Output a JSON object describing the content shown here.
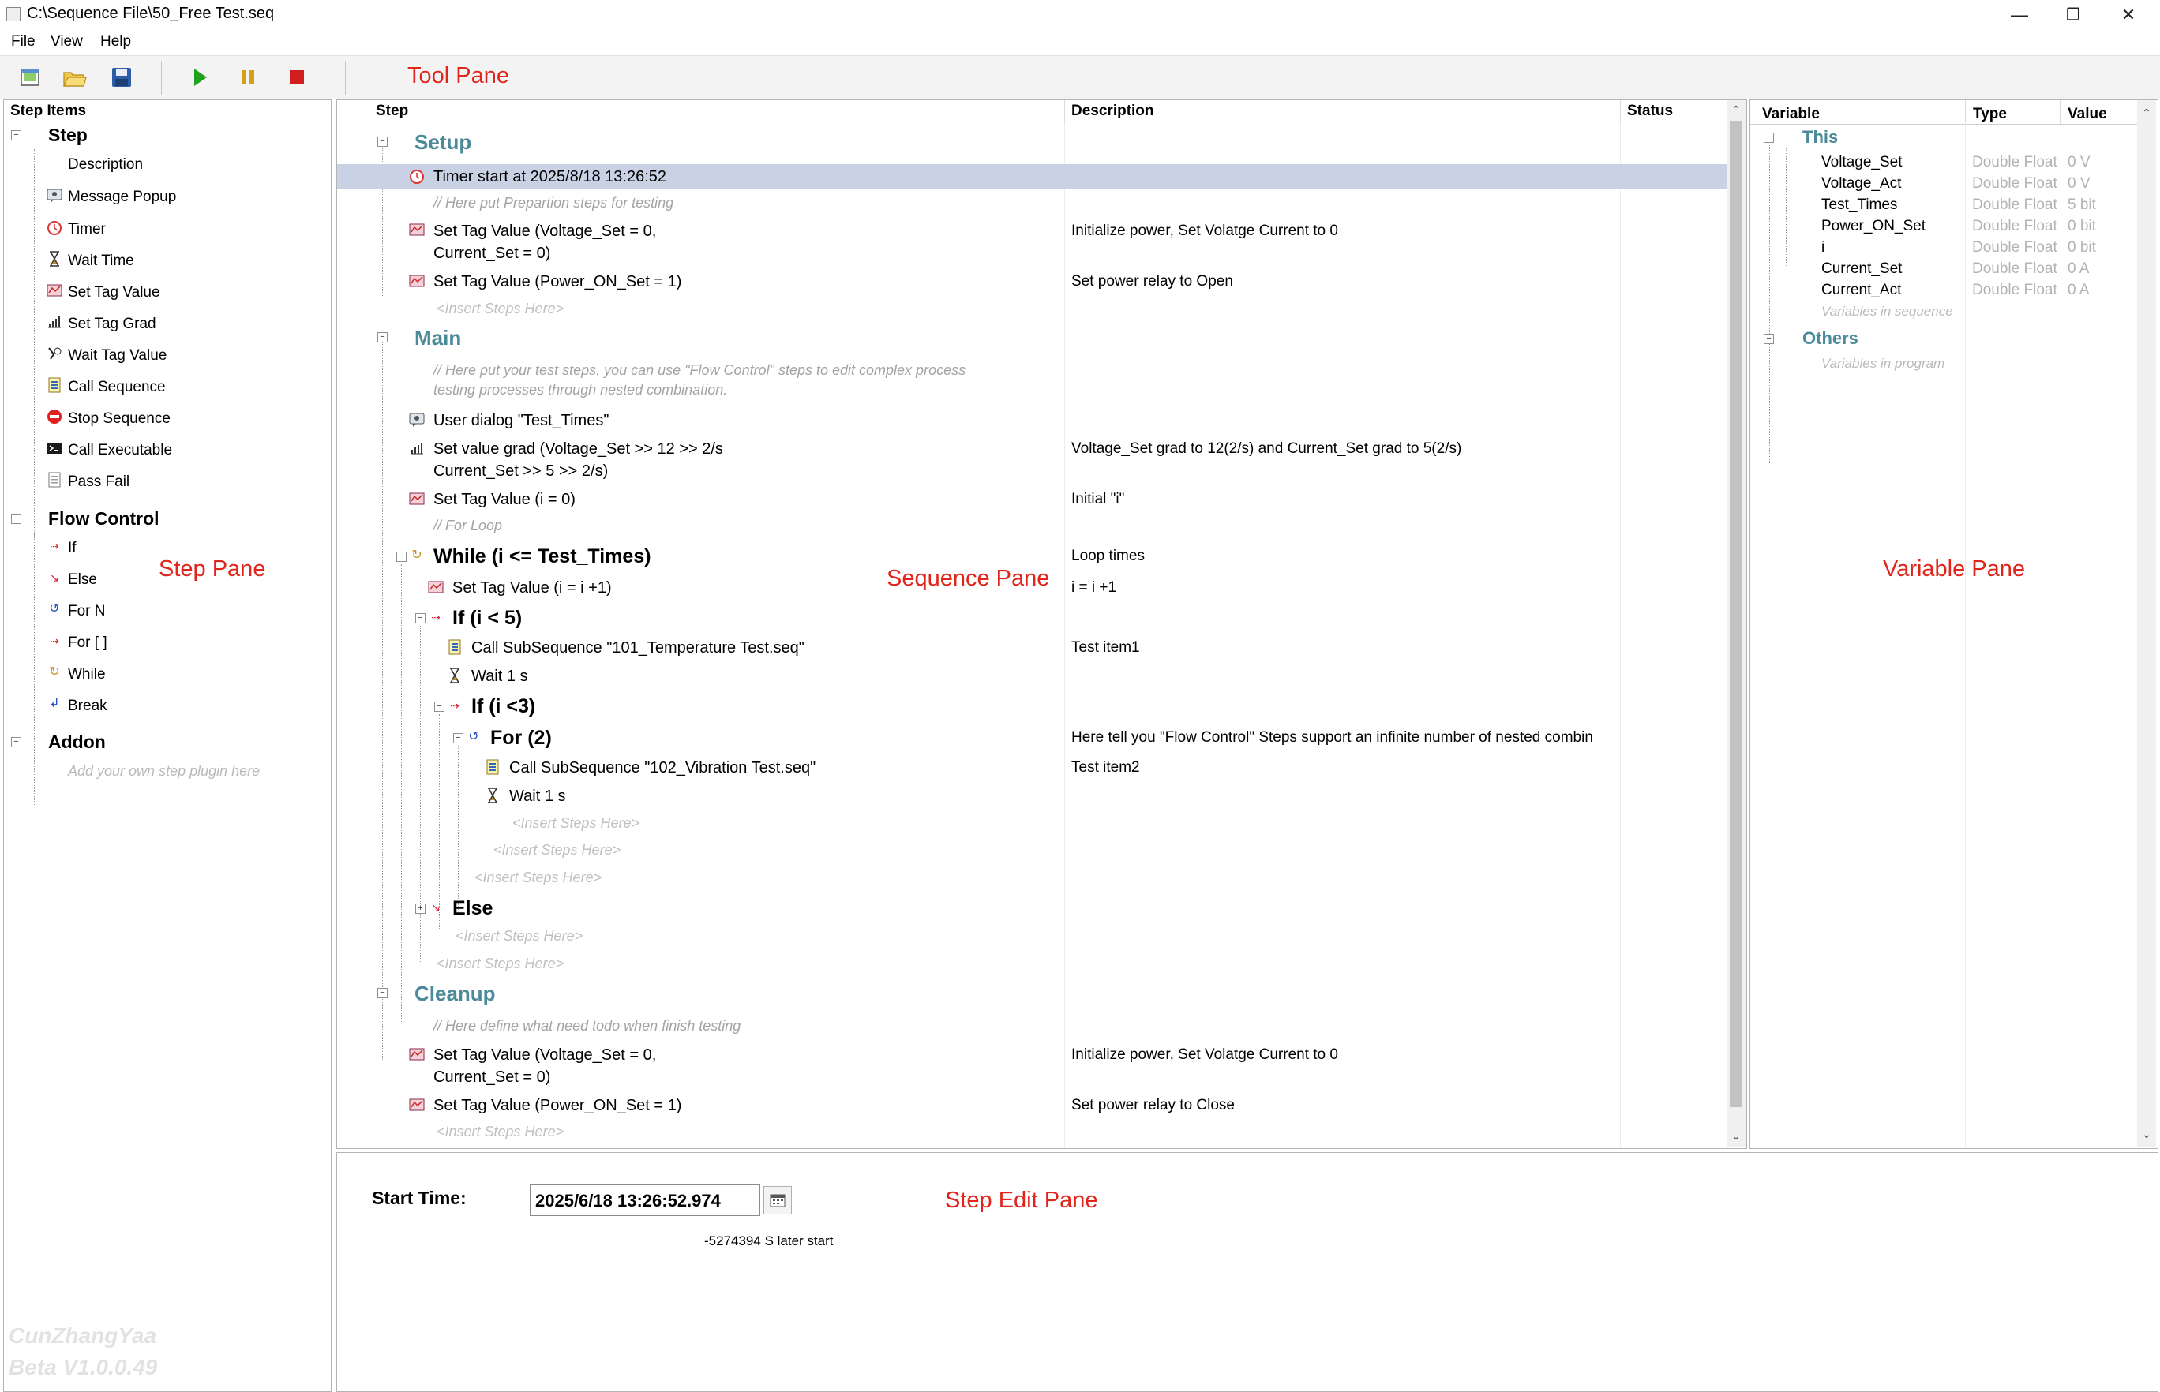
{
  "window": {
    "title": "C:\\Sequence File\\50_Free Test.seq",
    "minimize": "—",
    "restore": "❐",
    "close": "✕"
  },
  "menu": [
    "File",
    "View",
    "Help"
  ],
  "toolbar": {
    "buttons": [
      "new-icon",
      "open-icon",
      "save-icon",
      "run-icon",
      "pause-icon",
      "stop-icon"
    ],
    "colors": {
      "run": "#1fa31f",
      "pause": "#d4a017",
      "stop": "#d11f1f"
    }
  },
  "annotations": {
    "tool_pane": "Tool Pane",
    "step_pane": "Step Pane",
    "sequence_pane": "Sequence Pane",
    "variable_pane": "Variable Pane",
    "step_edit_pane": "Step Edit Pane"
  },
  "step_pane": {
    "header": "Step Items",
    "groups": [
      {
        "name": "Step",
        "items": [
          "Description",
          "Message Popup",
          "Timer",
          "Wait Time",
          "Set Tag Value",
          "Set Tag Grad",
          "Wait Tag Value",
          "Call Sequence",
          "Stop Sequence",
          "Call Executable",
          "Pass Fail"
        ]
      },
      {
        "name": "Flow Control",
        "items": [
          "If",
          "Else",
          "For N",
          "For [ ]",
          "While",
          "Break"
        ]
      },
      {
        "name": "Addon",
        "items": []
      }
    ],
    "addon_hint": "Add your own step plugin here",
    "watermark": [
      "CunZhangYaa",
      "Beta V1.0.0.49"
    ]
  },
  "sequence_pane": {
    "columns": [
      "Step",
      "Description",
      "Status"
    ],
    "setup": {
      "title": "Setup",
      "timer": "Timer start at 2025/8/18 13:26:52",
      "comment": "// Here put Prepartion steps for testing",
      "set1_line1": "Set Tag Value (Voltage_Set = 0,",
      "set1_line2": "Current_Set = 0)",
      "set1_desc": "Initialize power, Set Volatge Current to 0",
      "set2": "Set Tag Value (Power_ON_Set = 1)",
      "set2_desc": "Set power relay to Open",
      "insert": "<Insert Steps Here>"
    },
    "main": {
      "title": "Main",
      "comment_line1": "// Here put your test steps, you can use \"Flow Control\" steps to edit complex process",
      "comment_line2": "testing processes through nested combination.",
      "dialog": "User dialog \"Test_Times\"",
      "grad_line1": "Set value grad (Voltage_Set >> 12 >> 2/s",
      "grad_line2": "Current_Set >> 5 >> 2/s)",
      "grad_desc": "Voltage_Set grad to 12(2/s) and Current_Set grad to 5(2/s)",
      "seti": "Set Tag Value (i = 0)",
      "seti_desc": "Initial \"i\"",
      "for_loop_comment": "// For Loop",
      "while": "While (i <= Test_Times)",
      "while_desc": "Loop times",
      "inc": "Set Tag Value (i = i +1)",
      "inc_desc": "i = i +1",
      "if1": "If (i < 5)",
      "call1": "Call SubSequence \"101_Temperature Test.seq\"",
      "call1_desc": "Test item1",
      "wait1": "Wait 1 s",
      "if2": "If (i <3)",
      "for2": "For (2)",
      "for2_desc": "Here tell you \"Flow Control\" Steps support an infinite number of nested combin",
      "call2": "Call SubSequence \"102_Vibration Test.seq\"",
      "call2_desc": "Test item2",
      "wait2": "Wait 1 s",
      "else": "Else",
      "insert": "<Insert Steps Here>"
    },
    "cleanup": {
      "title": "Cleanup",
      "comment": "// Here define what need todo when finish testing",
      "set1_line1": "Set Tag Value (Voltage_Set = 0,",
      "set1_line2": "Current_Set = 0)",
      "set1_desc": "Initialize power, Set Volatge Current to 0",
      "set2": "Set Tag Value (Power_ON_Set = 1)",
      "set2_desc": "Set power relay to Close",
      "insert": "<Insert Steps Here>"
    }
  },
  "variable_pane": {
    "columns": [
      "Variable",
      "Type",
      "Value"
    ],
    "this_title": "This",
    "variables": [
      {
        "name": "Voltage_Set",
        "type": "Double Float",
        "value": "0 V"
      },
      {
        "name": "Voltage_Act",
        "type": "Double Float",
        "value": "0 V"
      },
      {
        "name": "Test_Times",
        "type": "Double Float",
        "value": "5 bit"
      },
      {
        "name": "Power_ON_Set",
        "type": "Double Float",
        "value": "0 bit"
      },
      {
        "name": "i",
        "type": "Double Float",
        "value": "0 bit"
      },
      {
        "name": "Current_Set",
        "type": "Double Float",
        "value": "0 A"
      },
      {
        "name": "Current_Act",
        "type": "Double Float",
        "value": "0 A"
      }
    ],
    "this_hint": "Variables in sequence",
    "others_title": "Others",
    "others_hint": "Variables in program"
  },
  "step_edit": {
    "start_time_label": "Start Time:",
    "start_time_value": "2025/6/18 13:26:52.974",
    "later_start": "-5274394 S later start"
  }
}
